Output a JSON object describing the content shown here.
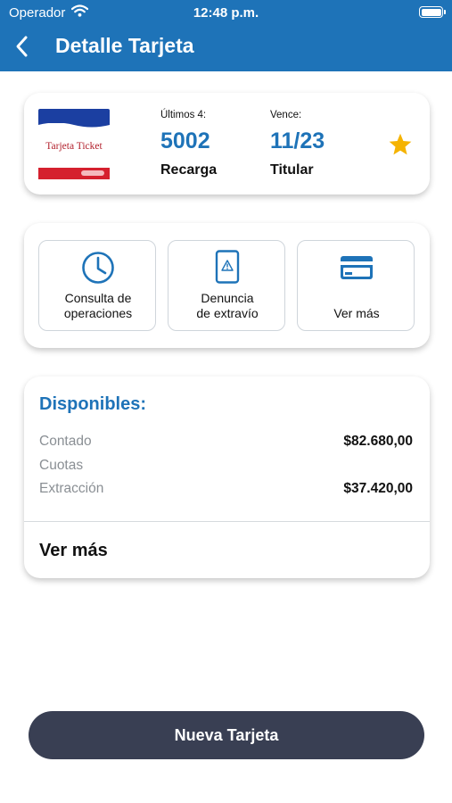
{
  "status_bar": {
    "carrier": "Operador",
    "time": "12:48 p.m.",
    "battery_level": 1.0
  },
  "header": {
    "title": "Detalle Tarjeta",
    "back_icon": "chevron-left-icon",
    "background": "#1e73b8"
  },
  "card_summary": {
    "thumbnail_text": "Tarjeta Ticket",
    "last4_label": "Últimos 4:",
    "last4_value": "5002",
    "type": "Recarga",
    "expiry_label": "Vence:",
    "expiry_value": "11/23",
    "holder": "Titular",
    "favorite": true,
    "favorite_icon": "star-icon",
    "favorite_color": "#f5b301"
  },
  "actions": [
    {
      "label_line1": "Consulta de",
      "label_line2": "operaciones",
      "icon": "clock-icon"
    },
    {
      "label_line1": "Denuncia",
      "label_line2": "de extravío",
      "icon": "warning-phone-icon"
    },
    {
      "label": "Ver más",
      "icon": "credit-card-icon"
    }
  ],
  "balances": {
    "title": "Disponibles:",
    "rows": [
      {
        "label": "Contado",
        "value": "$82.680,00"
      },
      {
        "label": "Cuotas",
        "value": ""
      },
      {
        "label": "Extracción",
        "value": "$37.420,00"
      }
    ],
    "more_label": "Ver más"
  },
  "primary_button": {
    "label": "Nueva Tarjeta",
    "color": "#393f53"
  },
  "colors": {
    "accent": "#1e73b8",
    "text": "#111111",
    "muted": "#8a8f94"
  }
}
